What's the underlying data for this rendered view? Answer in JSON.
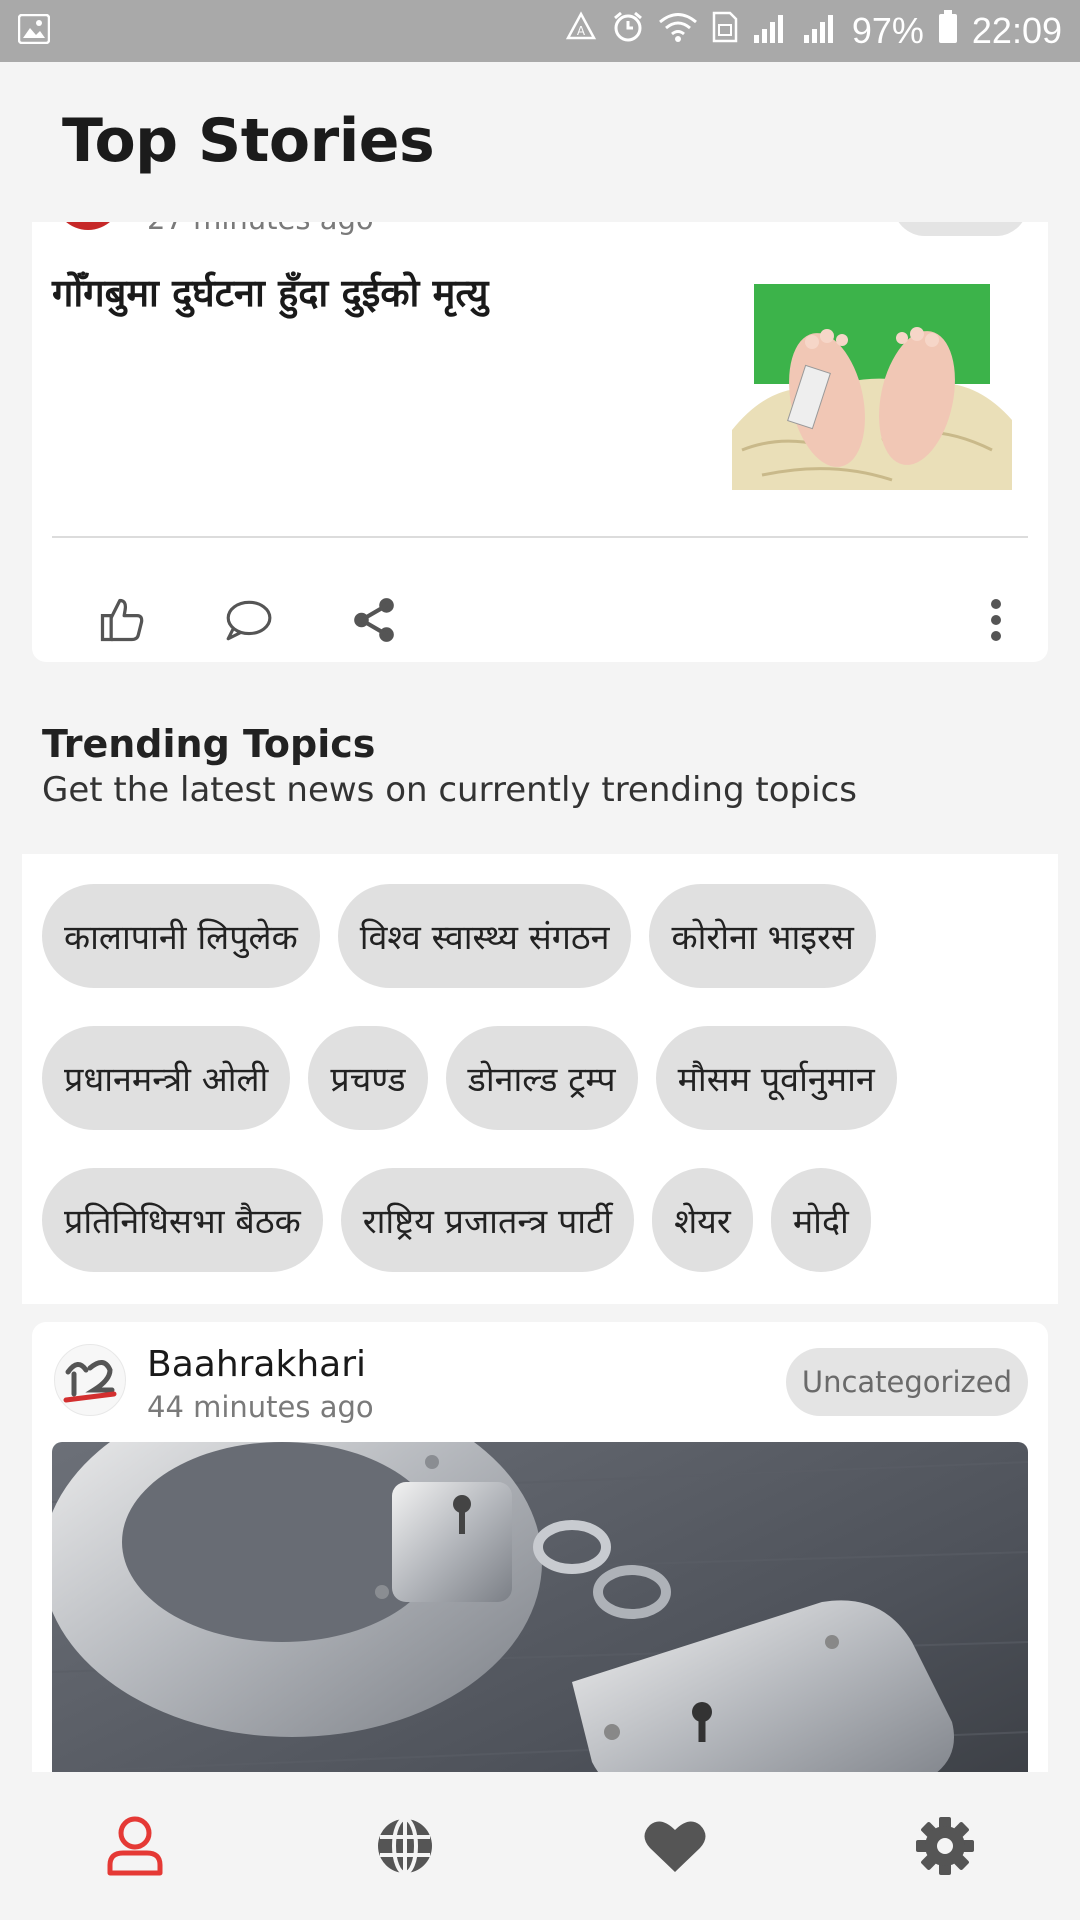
{
  "status_bar": {
    "battery": "97%",
    "time": "22:09"
  },
  "header": {
    "title": "Top Stories"
  },
  "story1": {
    "time": "27 minutes ago",
    "headline": "गोँगबुमा दुर्घटना हुँदा दुईको मृत्यु"
  },
  "trending": {
    "title": "Trending Topics",
    "subtitle": "Get the latest news on currently trending topics",
    "topics": [
      "कालापानी लिपुलेक",
      "विश्व स्वास्थ्य संगठन",
      "कोरोना भाइरस",
      "प्रधानमन्त्री ओली",
      "प्रचण्ड",
      "डोनाल्ड ट्रम्प",
      "मौसम पूर्वानुमान",
      "प्रतिनिधिसभा बैठक",
      "राष्ट्रिय प्रजातन्त्र पार्टी",
      "शेयर",
      "मोदी"
    ]
  },
  "story2": {
    "publisher": "Baahrakhari",
    "time": "44 minutes ago",
    "category": "Uncategorized"
  },
  "colors": {
    "accent": "#e53935",
    "icon_gray": "#555555",
    "chip_bg": "#e0e0e0"
  },
  "nav": [
    "profile-icon",
    "globe-icon",
    "heart-icon",
    "gear-icon"
  ]
}
